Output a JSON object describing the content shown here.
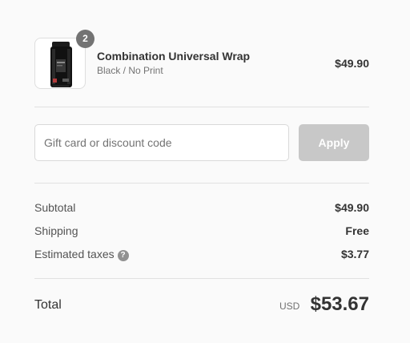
{
  "product": {
    "name": "Combination Universal Wrap",
    "variant": "Black / No Print",
    "price": "$49.90",
    "quantity": "2",
    "image_icon": "black-wrap-product-image"
  },
  "discount": {
    "placeholder": "Gift card or discount code",
    "value": "",
    "apply_label": "Apply"
  },
  "totals": {
    "subtotal_label": "Subtotal",
    "subtotal_value": "$49.90",
    "shipping_label": "Shipping",
    "shipping_value": "Free",
    "taxes_label": "Estimated taxes",
    "taxes_help_icon": "question-circle-icon",
    "taxes_help_glyph": "?",
    "taxes_value": "$3.77",
    "total_label": "Total",
    "currency": "USD",
    "total_value": "$53.67"
  },
  "colors": {
    "button_disabled": "#c8c8c8",
    "badge": "#737373",
    "divider": "#e1e1e1"
  }
}
